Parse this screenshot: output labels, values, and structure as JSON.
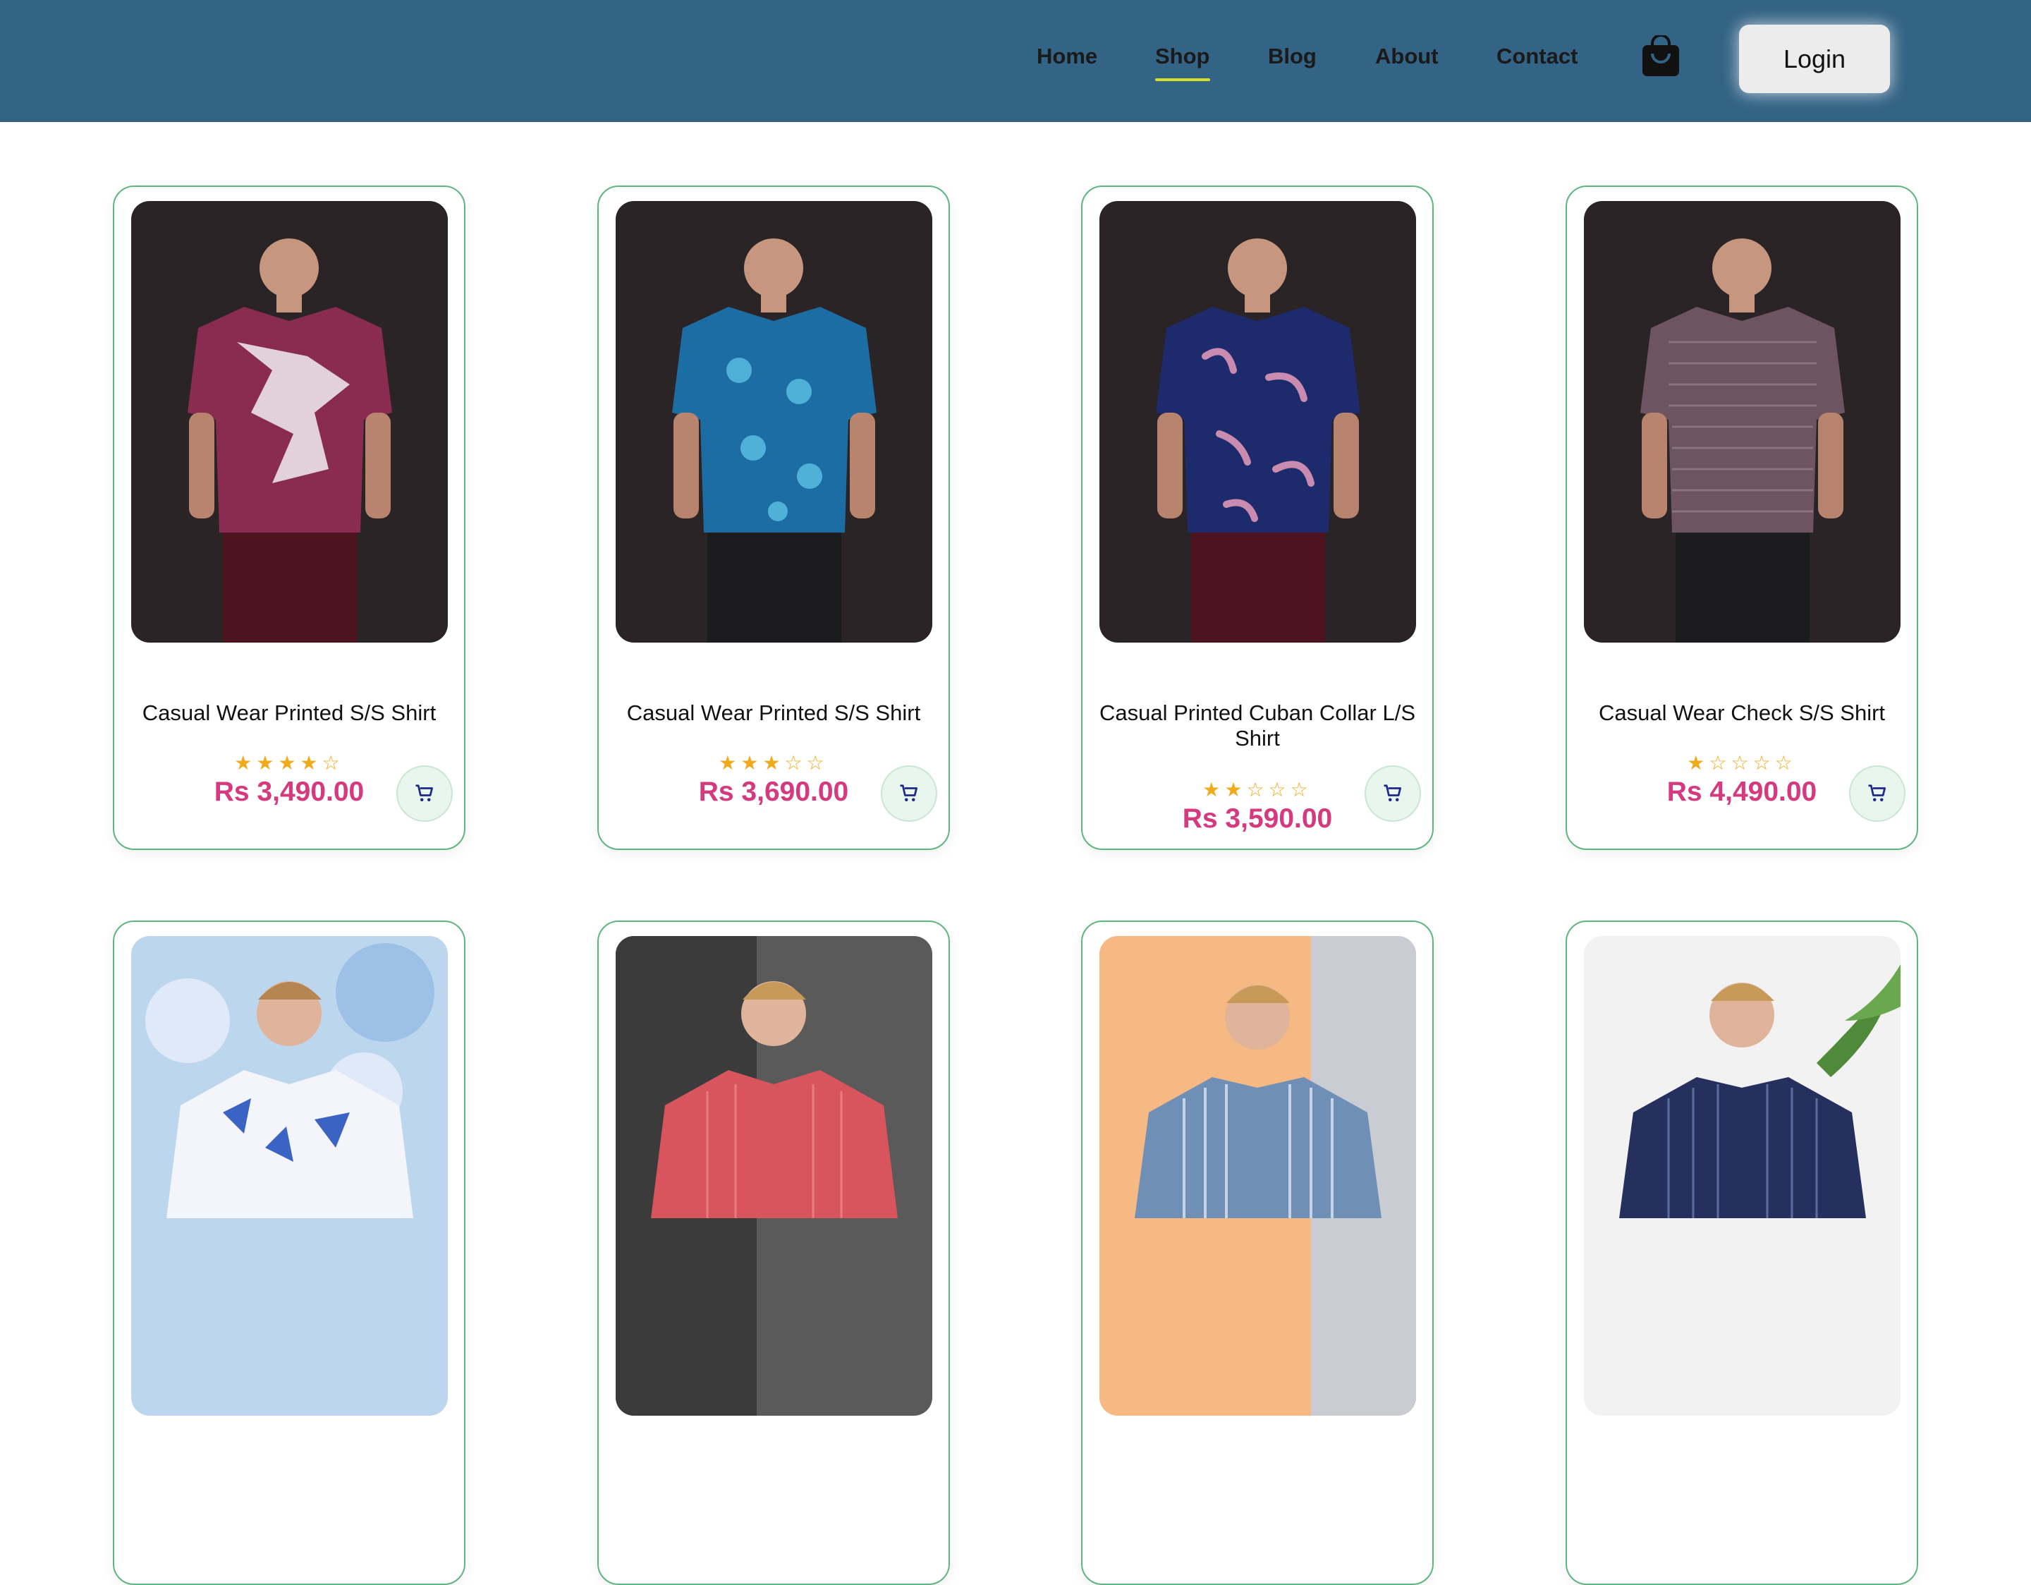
{
  "nav": {
    "links": [
      {
        "label": "Home",
        "active": false
      },
      {
        "label": "Shop",
        "active": true
      },
      {
        "label": "Blog",
        "active": false
      },
      {
        "label": "About",
        "active": false
      },
      {
        "label": "Contact",
        "active": false
      }
    ],
    "bag_icon": "shopping-bag-icon",
    "login_label": "Login"
  },
  "products": [
    {
      "title": "Casual Wear Printed S/S Shirt",
      "stars": "★★★★☆",
      "rating": 4,
      "price": "Rs 3,490.00",
      "shirt_color": "#8a2c4f",
      "shirt_accent": "#f1eef0"
    },
    {
      "title": "Casual Wear Printed S/S Shirt",
      "stars": "★★★☆☆",
      "rating": 3,
      "price": "Rs 3,690.00",
      "shirt_color": "#1b6da3",
      "shirt_accent": "#4fb1d8"
    },
    {
      "title": "Casual Printed Cuban Collar L/S Shirt",
      "stars": "★★☆☆☆",
      "rating": 2,
      "price": "Rs 3,590.00",
      "shirt_color": "#1d2a6b",
      "shirt_accent": "#c98bb0"
    },
    {
      "title": "Casual Wear Check S/S Shirt",
      "stars": "★☆☆☆☆",
      "rating": 1,
      "price": "Rs 4,490.00",
      "shirt_color": "#6e5460",
      "shirt_accent": "#8a7280"
    }
  ],
  "products_row2": [
    {
      "shirt_color": "#f3f5fb",
      "shirt_accent": "#3a63c4",
      "bg": "#bcd6ee"
    },
    {
      "shirt_color": "#d9555e",
      "shirt_accent": "#e77c82",
      "bg": "#5a5a5a"
    },
    {
      "shirt_color": "#6f8fb6",
      "shirt_accent": "#c4d4e6",
      "bg": "#f6b983"
    },
    {
      "shirt_color": "#26305f",
      "shirt_accent": "#5a6ca0",
      "bg": "#f2f2f2"
    }
  ],
  "cart_icon": "shopping-cart-icon"
}
